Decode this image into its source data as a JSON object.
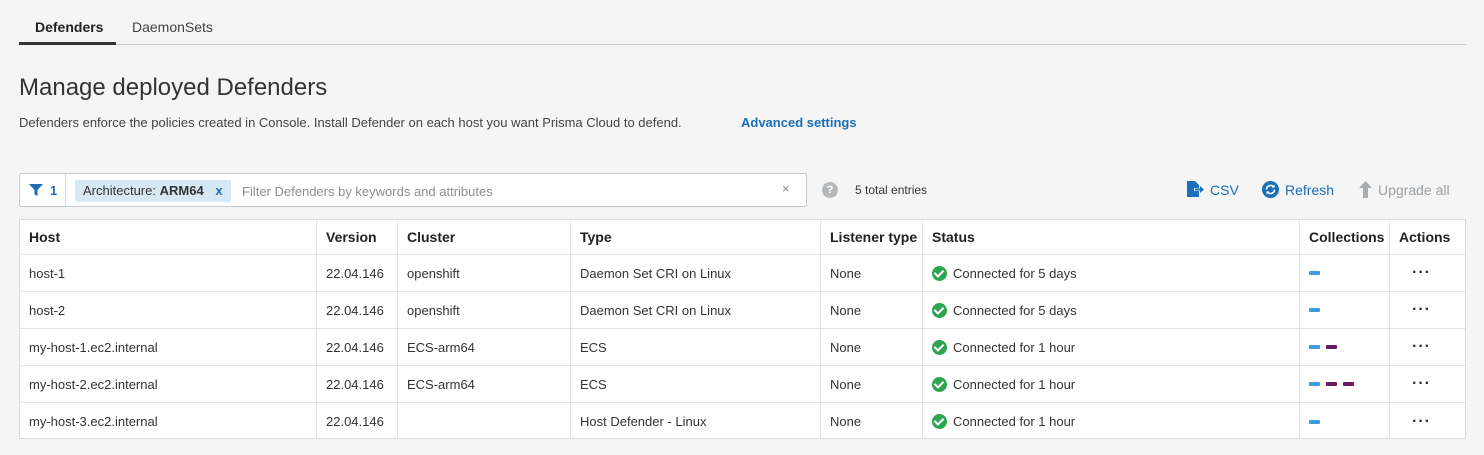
{
  "tabs": [
    {
      "label": "Defenders",
      "active": true
    },
    {
      "label": "DaemonSets",
      "active": false
    }
  ],
  "page": {
    "title": "Manage deployed Defenders",
    "description": "Defenders enforce the policies created in Console. Install Defender on each host you want Prisma Cloud to defend.",
    "advanced_link": "Advanced settings"
  },
  "filter": {
    "count": "1",
    "chip_key": "Architecture:",
    "chip_value": "ARM64",
    "chip_remove": "x",
    "placeholder": "Filter Defenders by keywords and attributes",
    "clear": "×"
  },
  "help": "?",
  "total_entries": "5 total entries",
  "toolbar": {
    "csv": "CSV",
    "refresh": "Refresh",
    "upgrade_all": "Upgrade all"
  },
  "colors": {
    "accent": "#1a6fb8",
    "status_ok": "#2ea44f",
    "collection_blue": "#3d9be0",
    "collection_purple": "#6e1a62"
  },
  "table": {
    "columns": [
      "Host",
      "Version",
      "Cluster",
      "Type",
      "Listener type",
      "Status",
      "Collections",
      "Actions"
    ],
    "rows": [
      {
        "host": "host-1",
        "version": "22.04.146",
        "cluster": "openshift",
        "type": "Daemon Set CRI on Linux",
        "listener": "None",
        "status": "Connected for 5 days",
        "collections": [
          "blue"
        ],
        "actions": "···"
      },
      {
        "host": "host-2",
        "version": "22.04.146",
        "cluster": "openshift",
        "type": "Daemon Set CRI on Linux",
        "listener": "None",
        "status": "Connected for 5 days",
        "collections": [
          "blue"
        ],
        "actions": "···"
      },
      {
        "host": "my-host-1.ec2.internal",
        "version": "22.04.146",
        "cluster": "ECS-arm64",
        "type": "ECS",
        "listener": "None",
        "status": "Connected for 1 hour",
        "collections": [
          "blue",
          "purple"
        ],
        "actions": "···"
      },
      {
        "host": "my-host-2.ec2.internal",
        "version": "22.04.146",
        "cluster": "ECS-arm64",
        "type": "ECS",
        "listener": "None",
        "status": "Connected for 1 hour",
        "collections": [
          "blue",
          "purple",
          "purple"
        ],
        "actions": "···"
      },
      {
        "host": "my-host-3.ec2.internal",
        "version": "22.04.146",
        "cluster": "",
        "type": "Host Defender - Linux",
        "listener": "None",
        "status": "Connected for 1 hour",
        "collections": [
          "blue"
        ],
        "actions": "···"
      }
    ]
  }
}
